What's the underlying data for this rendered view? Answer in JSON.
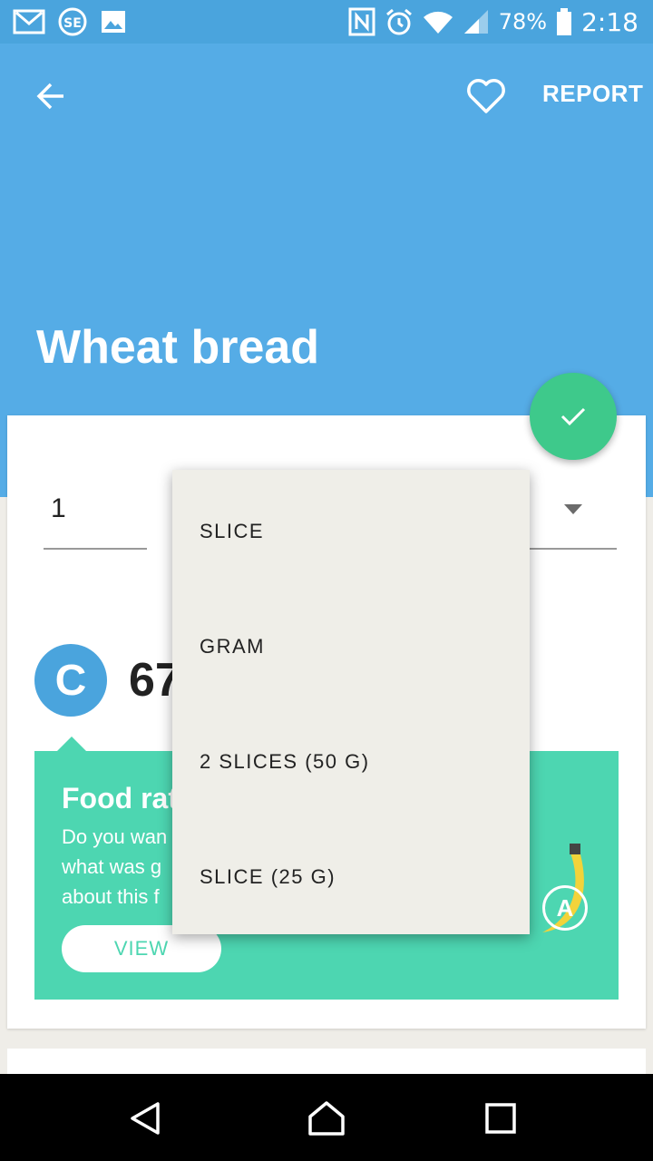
{
  "status_bar": {
    "battery": "78%",
    "time": "2:18",
    "icons": [
      "gmail-icon",
      "se-icon",
      "image-icon",
      "nfc-icon",
      "alarm-icon",
      "wifi-icon",
      "signal-icon",
      "battery-icon"
    ]
  },
  "header": {
    "title": "Wheat bread",
    "report_label": "REPORT"
  },
  "form": {
    "quantity": "1"
  },
  "dropdown": {
    "options": [
      "SLICE",
      "GRAM",
      "2 SLICES (50 G)",
      "SLICE (25 G)"
    ]
  },
  "score": {
    "grade": "C",
    "value_visible": "67"
  },
  "food_rating": {
    "title": "Food rat",
    "body_lines": [
      "Do you wan",
      "what was g",
      "about this f"
    ],
    "view_label": "VIEW",
    "badge": "A"
  },
  "colors": {
    "header": "#55ace6",
    "fab": "#3ec98b",
    "rating_box": "#4dd6b1",
    "grade_badge": "#4aa4dd"
  }
}
